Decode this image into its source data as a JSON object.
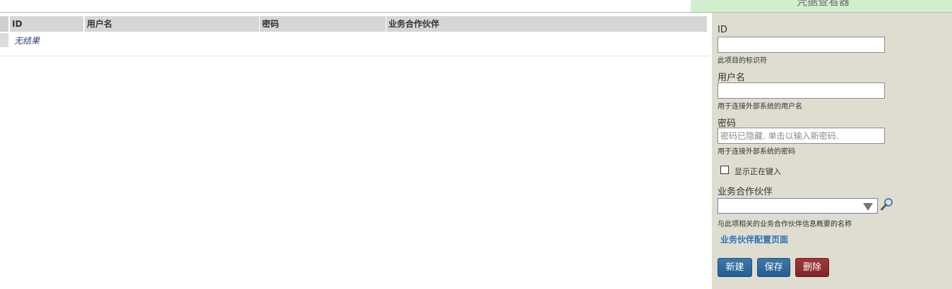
{
  "panel_title": "凭据查看器",
  "table": {
    "columns": [
      "ID",
      "用户名",
      "密码",
      "业务合作伙伴"
    ],
    "empty_text": "无结果"
  },
  "form": {
    "id_label": "ID",
    "id_hint": "此项目的标识符",
    "id_value": "",
    "username_label": "用户名",
    "username_hint": "用于连接外部系统的用户名",
    "username_value": "",
    "password_label": "密码",
    "password_placeholder": "密码已隐藏. 单击以输入新密码.",
    "password_hint": "用于连接外部系统的密码",
    "show_typing_label": "显示正在键入",
    "show_typing_checked": false,
    "partner_label": "业务合作伙伴",
    "partner_value": "",
    "partner_hint": "与此项相关的业务合作伙伴信息概要的名称",
    "partner_config_link": "业务伙伴配置页面",
    "new_button": "新建",
    "save_button": "保存",
    "delete_button": "删除"
  },
  "colors": {
    "panel_bg": "#deddcf",
    "header_green": "#d1efcd",
    "button_blue": "#2f6a9d",
    "button_red": "#93302f",
    "link_blue": "#2f72b5"
  }
}
